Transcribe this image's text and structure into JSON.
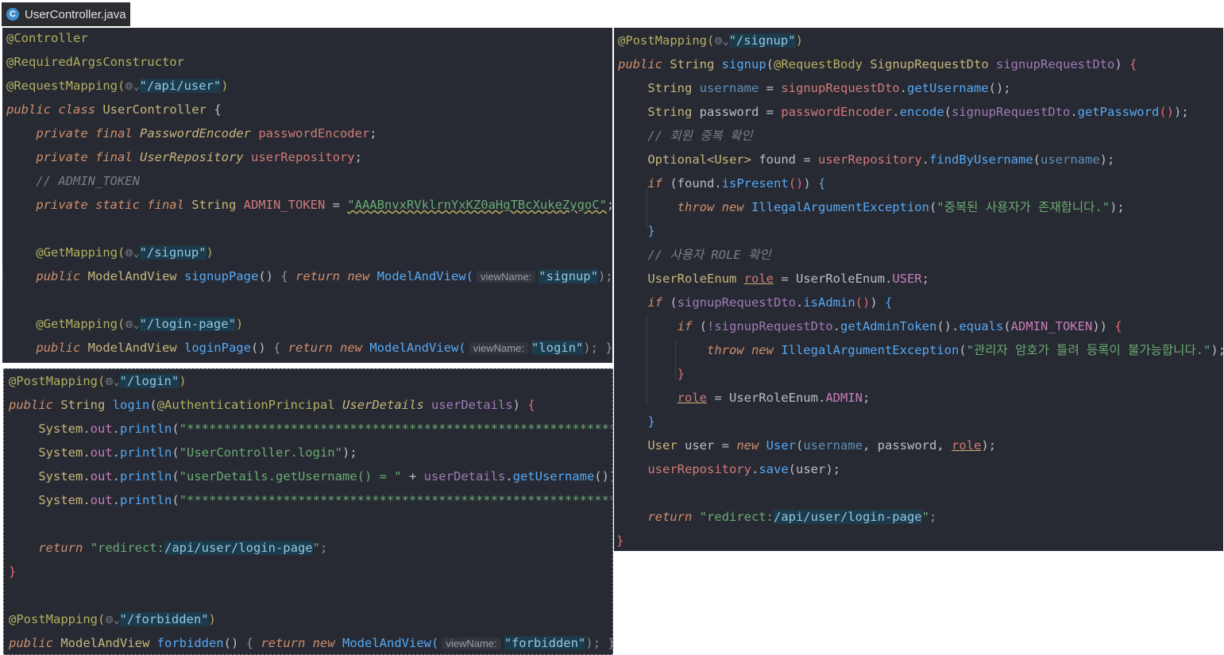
{
  "tab": {
    "icon": "C",
    "filename": "UserController.java"
  },
  "top": {
    "l1": "@Controller",
    "l2": "@RequiredArgsConstructor",
    "l3_ann": "@RequestMapping(",
    "l3_url": "\"/api/user\"",
    "l3_close": ")",
    "l4_kw": "public class ",
    "l4_cls": "UserController",
    "l4_end": " {",
    "l5_kw": "private final ",
    "l5_type": "PasswordEncoder",
    "l5_var": "passwordEncoder",
    "l6_kw": "private final ",
    "l6_type": "UserRepository",
    "l6_var": "userRepository",
    "l7": "// ADMIN_TOKEN",
    "l8_kw": "private static final ",
    "l8_type": "String",
    "l8_var": "ADMIN_TOKEN",
    "l8_eq": " = ",
    "l8_val": "\"AAABnvxRVklrnYxKZ0aHgTBcXukeZygoC\"",
    "l10_ann": "@GetMapping(",
    "l10_url": "\"/signup\"",
    "l11_kw": "public ",
    "l11_type": "ModelAndView",
    "l11_fn": "signupPage",
    "l11_body_kw": "return new ",
    "l11_body_cls": "ModelAndView(",
    "l11_hint": "viewName:",
    "l11_str": "\"signup\"",
    "l11_end": "); }",
    "l13_ann": "@GetMapping(",
    "l13_url": "\"/login-page\"",
    "l14_kw": "public ",
    "l14_type": "ModelAndView",
    "l14_fn": "loginPage",
    "l14_body_kw": "return new ",
    "l14_body_cls": "ModelAndView(",
    "l14_hint": "viewName:",
    "l14_str": "\"login\"",
    "l14_end": "); }"
  },
  "bottom": {
    "l1_ann": "@PostMapping(",
    "l1_url": "\"/login\"",
    "l2_kw": "public ",
    "l2_type": "String",
    "l2_fn": "login",
    "l2_ann": "@AuthenticationPrincipal",
    "l2_ptype": "UserDetails",
    "l2_par": "userDetails",
    "l3_arg": "\"*****************************************************************\"",
    "l4_arg": "\"UserController.login\"",
    "l5_arg": "\"userDetails.getUsername() = \"",
    "l5_par": "userDetails",
    "l5_fn": "getUsername",
    "l6_arg": "\"*****************************************************************\"",
    "l8_kw": "return ",
    "l8_pre": "\"redirect:",
    "l8_path": "/api/user/login-page",
    "l8_post": "\";",
    "l9": "}",
    "l11_ann": "@PostMapping(",
    "l11_url": "\"/forbidden\"",
    "l12_kw": "public ",
    "l12_type": "ModelAndView",
    "l12_fn": "forbidden",
    "l12_body_kw": "return new ",
    "l12_body_cls": "ModelAndView(",
    "l12_hint": "viewName:",
    "l12_str": "\"forbidden\"",
    "l12_end": "); }",
    "sysout": "System.",
    "out": "out",
    "println": "println"
  },
  "right": {
    "l1_ann": "@PostMapping(",
    "l1_url": "\"/signup\"",
    "l2_kw": "public ",
    "l2_type": "String",
    "l2_fn": "signup",
    "l2_ann": "@RequestBody",
    "l2_ptype": "SignupRequestDto",
    "l2_par": "signupRequestDto",
    "l3_type": "String",
    "l3_var": "username",
    "l3_par": "signupRequestDto",
    "l3_fn": "getUsername",
    "l4_type": "String",
    "l4_var": "password",
    "l4_field": "passwordEncoder",
    "l4_fn": "encode",
    "l4_par": "signupRequestDto",
    "l4_fn2": "getPassword",
    "l5": "// 회원 중복 확인",
    "l6_type": "Optional<User>",
    "l6_var": "found",
    "l6_field": "userRepository",
    "l6_fn": "findByUsername",
    "l6_arg": "username",
    "l7_kw": "if",
    "l7_var": "found",
    "l7_fn": "isPresent",
    "l8_kw": "throw new ",
    "l8_cls": "IllegalArgumentException",
    "l8_str": "\"중복된 사용자가 존재합니다.\"",
    "l9": "}",
    "l10": "// 사용자 ROLE 확인",
    "l11_type": "UserRoleEnum",
    "l11_var": "role",
    "l11_val": "UserRoleEnum.",
    "l11_const": "USER",
    "l12_kw": "if",
    "l12_par": "signupRequestDto",
    "l12_fn": "isAdmin",
    "l13_kw": "if",
    "l13_par": "!signupRequestDto",
    "l13_fn": "getAdminToken",
    "l13_fn2": "equals",
    "l13_const": "ADMIN_TOKEN",
    "l14_kw": "throw new ",
    "l14_cls": "IllegalArgumentException",
    "l14_str": "\"관리자 암호가 틀려 등록이 불가능합니다.\"",
    "l15": "}",
    "l16_var": "role",
    "l16_val": "UserRoleEnum.",
    "l16_const": "ADMIN",
    "l17": "}",
    "l18_type": "User",
    "l18_var": "user",
    "l18_kw": "new ",
    "l18_cls": "User",
    "l18_a1": "username",
    "l18_a2": "password",
    "l18_a3": "role",
    "l19_field": "userRepository",
    "l19_fn": "save",
    "l19_arg": "user",
    "l21_kw": "return ",
    "l21_pre": "\"redirect:",
    "l21_path": "/api/user/login-page",
    "l21_post": "\";",
    "l22": "}"
  },
  "icons": {
    "tab": "java-class-icon",
    "globe": "globe-icon"
  }
}
